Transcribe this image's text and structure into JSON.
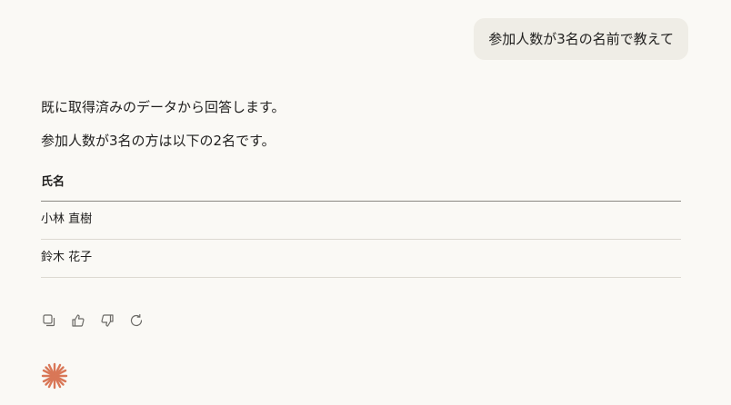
{
  "user_message": "参加人数が3名の名前で教えて",
  "assistant": {
    "paragraphs": [
      "既に取得済みのデータから回答します。",
      "参加人数が3名の方は以下の2名です。"
    ],
    "table": {
      "header": "氏名",
      "rows": [
        "小林 直樹",
        "鈴木 花子"
      ]
    }
  },
  "actions": [
    "copy-icon",
    "thumbs-up-icon",
    "thumbs-down-icon",
    "retry-icon"
  ],
  "colors": {
    "background": "#faf9f5",
    "bubble": "#efede6",
    "accent": "#d97757",
    "icon": "#6b6a66"
  }
}
